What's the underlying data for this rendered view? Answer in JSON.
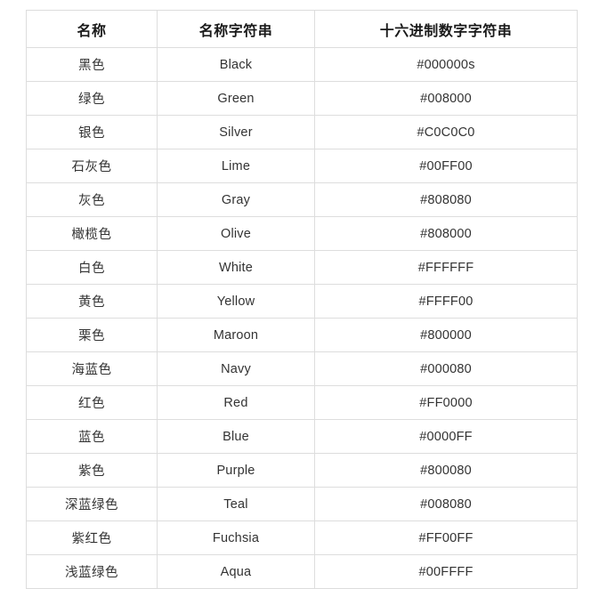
{
  "table": {
    "headers": [
      "名称",
      "名称字符串",
      "十六进制数字字符串"
    ],
    "rows": [
      {
        "name": "黑色",
        "string": "Black",
        "hex": "#000000s"
      },
      {
        "name": "绿色",
        "string": "Green",
        "hex": "#008000"
      },
      {
        "name": "银色",
        "string": "Silver",
        "hex": "#C0C0C0"
      },
      {
        "name": "石灰色",
        "string": "Lime",
        "hex": "#00FF00"
      },
      {
        "name": "灰色",
        "string": "Gray",
        "hex": "#808080"
      },
      {
        "name": "橄榄色",
        "string": "Olive",
        "hex": "#808000"
      },
      {
        "name": "白色",
        "string": "White",
        "hex": "#FFFFFF"
      },
      {
        "name": "黄色",
        "string": "Yellow",
        "hex": "#FFFF00"
      },
      {
        "name": "栗色",
        "string": "Maroon",
        "hex": "#800000"
      },
      {
        "name": "海蓝色",
        "string": "Navy",
        "hex": "#000080"
      },
      {
        "name": "红色",
        "string": "Red",
        "hex": "#FF0000"
      },
      {
        "name": "蓝色",
        "string": "Blue",
        "hex": "#0000FF"
      },
      {
        "name": "紫色",
        "string": "Purple",
        "hex": "#800080"
      },
      {
        "name": "深蓝绿色",
        "string": "Teal",
        "hex": "#008080"
      },
      {
        "name": "紫红色",
        "string": "Fuchsia",
        "hex": "#FF00FF"
      },
      {
        "name": "浅蓝绿色",
        "string": "Aqua",
        "hex": "#00FFFF"
      }
    ]
  },
  "style": {
    "border_color": "#dddddd",
    "header_text_color": "#1a1a1a",
    "body_text_color": "#333333",
    "background": "#ffffff"
  }
}
